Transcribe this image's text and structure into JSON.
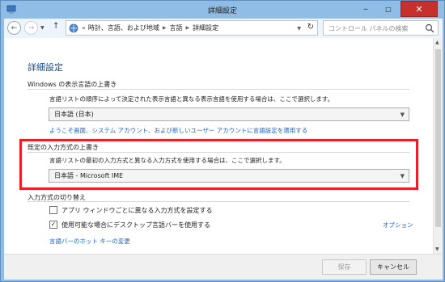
{
  "window": {
    "title": "詳細設定"
  },
  "controls": {
    "minimize": "─",
    "maximize": "□",
    "close": "✕"
  },
  "nav": {
    "back": "←",
    "forward": "→",
    "up": "↑",
    "overflow": "«",
    "breadcrumbs": [
      "時計、言語、および地域",
      "言語",
      "詳細設定"
    ],
    "search_placeholder": "コントロール パネルの検索"
  },
  "page": {
    "title": "詳細設定"
  },
  "display_language": {
    "heading": "Windows の表示言語の上書き",
    "description": "言語リストの順序によって決定された表示言語と異なる表示言語を使用する場合は、ここで選択します。",
    "selected": "日本語 (日本)",
    "link": "ようこそ画面、システム アカウント、および新しいユーザー アカウントに言語設定を適用する"
  },
  "input_method": {
    "heading": "既定の入力方式の上書き",
    "description": "言語リストの最初の入力方式と異なる入力方式を使用する場合は、ここで選択します。",
    "selected": "日本語 - Microsoft IME"
  },
  "switching": {
    "heading": "入力方式の切り替え",
    "checkbox1": {
      "label": "アプリ ウィンドウごとに異なる入力方式を設定する",
      "checked": false
    },
    "checkbox2": {
      "label": "使用可能な場合にデスクトップ言語バーを使用する",
      "checked": true,
      "mark": "✓"
    },
    "options_link": "オプション",
    "hotkey_link": "言語バーのホット キーの変更"
  },
  "buttons": {
    "save": "保存",
    "cancel": "キャンセル"
  },
  "colors": {
    "highlight": "#e3222a",
    "link": "#1d64c7",
    "title": "#1a4a8a"
  }
}
